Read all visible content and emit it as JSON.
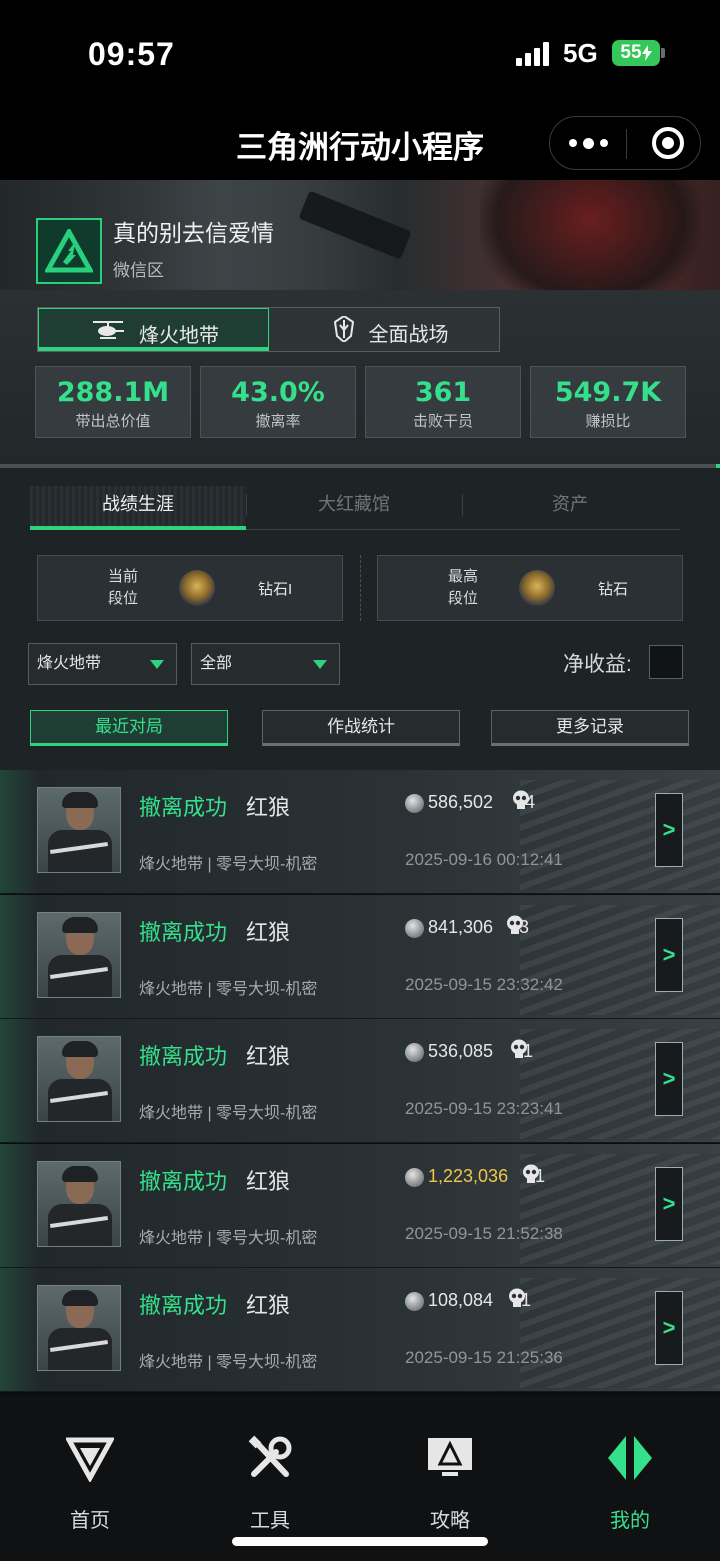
{
  "status": {
    "time": "09:57",
    "network": "5G",
    "battery": "55"
  },
  "titlebar": {
    "title": "三角洲行动小程序"
  },
  "profile": {
    "name": "真的别去信爱情",
    "region": "微信区"
  },
  "mode_tabs": [
    {
      "label": "烽火地带",
      "icon": "helicopter-icon",
      "active": true
    },
    {
      "label": "全面战场",
      "icon": "battlefield-emblem-icon",
      "active": false
    }
  ],
  "stats": [
    {
      "value": "288.1M",
      "label": "带出总价值"
    },
    {
      "value": "43.0%",
      "label": "撤离率"
    },
    {
      "value": "361",
      "label": "击败干员"
    },
    {
      "value": "549.7K",
      "label": "赚损比"
    }
  ],
  "section_tabs": [
    {
      "label": "战绩生涯",
      "active": true
    },
    {
      "label": "大红藏馆",
      "active": false
    },
    {
      "label": "资产",
      "active": false
    }
  ],
  "rank": {
    "current": {
      "title_line1": "当前",
      "title_line2": "段位",
      "value": "钻石I"
    },
    "highest": {
      "title_line1": "最高",
      "title_line2": "段位",
      "value": "钻石"
    }
  },
  "filters": {
    "mode_value": "烽火地带",
    "scope_value": "全部",
    "net_income_label": "净收益:"
  },
  "sub_tabs": [
    {
      "label": "最近对局",
      "active": true
    },
    {
      "label": "作战统计",
      "active": false
    },
    {
      "label": "更多记录",
      "active": false
    }
  ],
  "matches": [
    {
      "result": "撤离成功",
      "operator": "红狼",
      "value": "586,502",
      "kills": "4",
      "mode_map": "烽火地带 | 零号大坝-机密",
      "time": "2025-09-16 00:12:41",
      "highlight": false
    },
    {
      "result": "撤离成功",
      "operator": "红狼",
      "value": "841,306",
      "kills": "3",
      "mode_map": "烽火地带 | 零号大坝-机密",
      "time": "2025-09-15 23:32:42",
      "highlight": false
    },
    {
      "result": "撤离成功",
      "operator": "红狼",
      "value": "536,085",
      "kills": "1",
      "mode_map": "烽火地带 | 零号大坝-机密",
      "time": "2025-09-15 23:23:41",
      "highlight": false
    },
    {
      "result": "撤离成功",
      "operator": "红狼",
      "value": "1,223,036",
      "kills": "1",
      "mode_map": "烽火地带 | 零号大坝-机密",
      "time": "2025-09-15 21:52:38",
      "highlight": true
    },
    {
      "result": "撤离成功",
      "operator": "红狼",
      "value": "108,084",
      "kills": "1",
      "mode_map": "烽火地带 | 零号大坝-机密",
      "time": "2025-09-15 21:25:36",
      "highlight": false
    }
  ],
  "detail_arrow": ">",
  "bottom_nav": [
    {
      "label": "首页",
      "icon": "home-logo-icon",
      "active": false
    },
    {
      "label": "工具",
      "icon": "tools-icon",
      "active": false
    },
    {
      "label": "攻略",
      "icon": "guide-monitor-icon",
      "active": false
    },
    {
      "label": "我的",
      "icon": "profile-logo-icon",
      "active": true
    }
  ],
  "colors": {
    "accent": "#35e08c",
    "gold": "#f1c64a",
    "background": "#0b0d0e"
  }
}
